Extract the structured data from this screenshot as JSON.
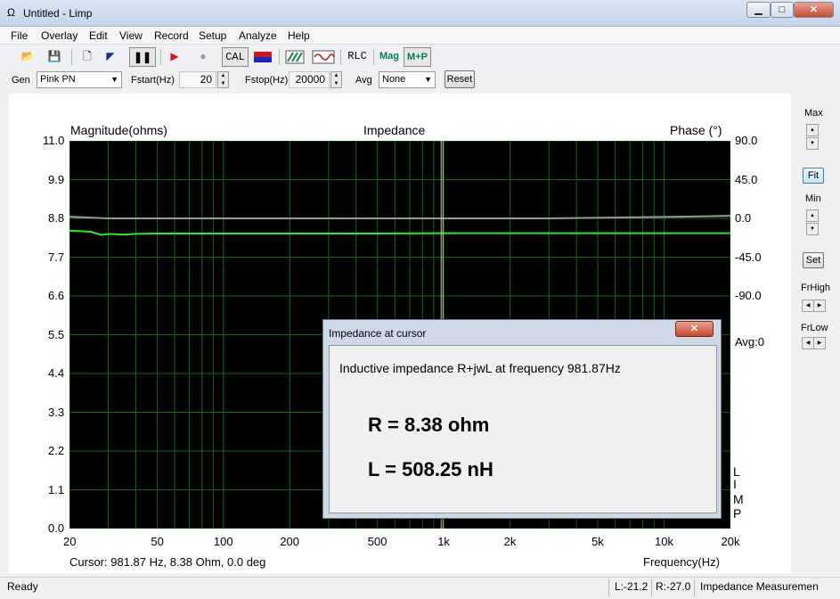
{
  "window": {
    "title": "Untitled - Limp",
    "app_icon": "Ω",
    "minimize": "▁",
    "maximize": "□",
    "close": "✕"
  },
  "menu": [
    "File",
    "Overlay",
    "Edit",
    "View",
    "Record",
    "Setup",
    "Analyze",
    "Help"
  ],
  "toolbar": {
    "open": "📂",
    "save": "💾",
    "copy": "🗋",
    "marker": "◤",
    "pause": "❚❚",
    "play": "▶",
    "stop": "●",
    "cal": "CAL",
    "rlc": "RLC",
    "mag": "Mag",
    "mp": "M+P"
  },
  "params": {
    "gen_label": "Gen",
    "gen_value": "Pink PN",
    "fstart_label": "Fstart(Hz)",
    "fstart_value": "20",
    "fstop_label": "Fstop(Hz)",
    "fstop_value": "20000",
    "avg_label": "Avg",
    "avg_value": "None",
    "reset": "Reset"
  },
  "right_panel": {
    "max": "Max",
    "fit": "Fit",
    "min": "Min",
    "set": "Set",
    "frhigh": "FrHigh",
    "frlow": "FrLow"
  },
  "chart_data": {
    "type": "line",
    "title": "Impedance",
    "ylabel": "Magnitude(ohms)",
    "ylabel_right": "Phase (°)",
    "xlabel": "Frequency(Hz)",
    "xscale": "log",
    "xlim": [
      20,
      20000
    ],
    "ylim": [
      0,
      11
    ],
    "ylim_right": [
      -360,
      90
    ],
    "grid": true,
    "background": "#000000",
    "x_ticks": [
      "20",
      "50",
      "100",
      "200",
      "500",
      "1k",
      "2k",
      "5k",
      "10k",
      "20k"
    ],
    "y_ticks": [
      "11.0",
      "9.9",
      "8.8",
      "7.7",
      "6.6",
      "5.5",
      "4.4",
      "3.3",
      "2.2",
      "1.1",
      "0.0"
    ],
    "y_right_ticks": [
      "90.0",
      "45.0",
      "0.0",
      "-45.0",
      "-90.0"
    ],
    "cursor_x": 981.87,
    "series": [
      {
        "color": "#22ee22",
        "axis": "left",
        "x": [
          20,
          25,
          28,
          30,
          35,
          40,
          50,
          70,
          100,
          200,
          500,
          1000,
          2000,
          5000,
          10000,
          20000
        ],
        "y": [
          8.45,
          8.42,
          8.33,
          8.36,
          8.34,
          8.36,
          8.37,
          8.37,
          8.37,
          8.37,
          8.37,
          8.38,
          8.38,
          8.38,
          8.38,
          8.38
        ]
      },
      {
        "color": "#999999",
        "axis": "right",
        "x": [
          20,
          30,
          3000,
          12000,
          20000
        ],
        "y": [
          2,
          0,
          0,
          2,
          3
        ]
      }
    ]
  },
  "limp_letters": [
    "L",
    "I",
    "M",
    "P"
  ],
  "avg_text": "Avg:0",
  "cursor_readout": "Cursor: 981.87 Hz, 8.38 Ohm, 0.0 deg",
  "dialog": {
    "title": "Impedance at cursor",
    "close": "✕",
    "description": "Inductive impedance R+jwL at frequency 981.87Hz",
    "r_text": "R = 8.38 ohm",
    "l_text": "L = 508.25 nH"
  },
  "status": {
    "ready": "Ready",
    "l_val": "L:-21.2",
    "r_val": "R:-27.0",
    "mode": "Impedance Measuremen"
  }
}
